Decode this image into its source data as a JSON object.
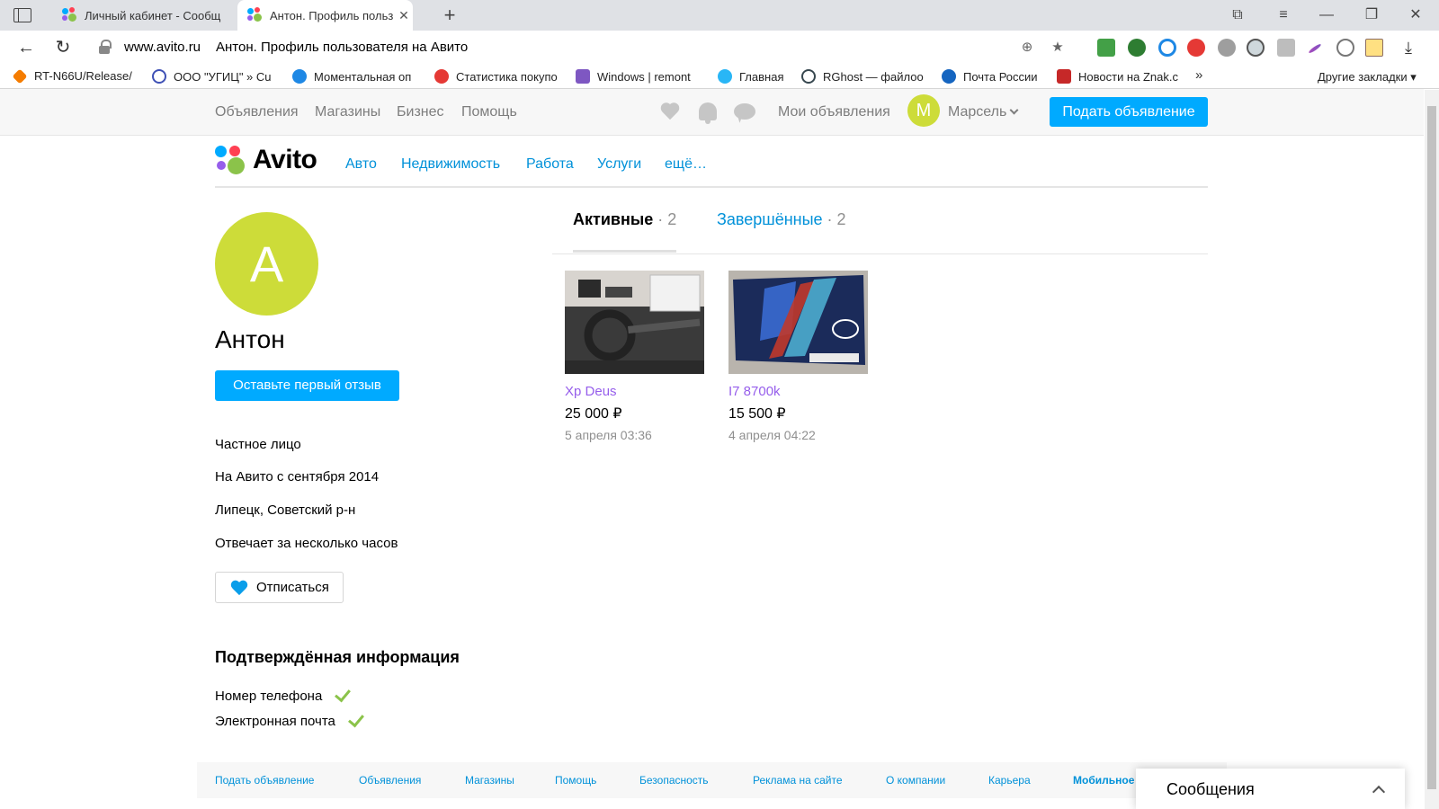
{
  "browser": {
    "tabs": [
      {
        "title": "Личный кабинет - Сообщ",
        "active": false
      },
      {
        "title": "Антон. Профиль польз",
        "active": true
      }
    ],
    "new_tab": "+",
    "close_glyph": "✕",
    "address": {
      "host": "www.avito.ru",
      "title": "Антон. Профиль пользователя на Авито"
    },
    "bookmarks": [
      {
        "label": "RT-N66U/Release/",
        "color": "#f57c00"
      },
      {
        "label": "ООО \"УГИЦ\" » Cu",
        "color": "#3f51b5"
      },
      {
        "label": "Моментальная оп",
        "color": "#1e88e5"
      },
      {
        "label": "Статистика покупо",
        "color": "#e53935"
      },
      {
        "label": "Windows | remont",
        "color": "#7e57c2"
      },
      {
        "label": "Главная",
        "color": "#29b6f6"
      },
      {
        "label": "RGhost — файлоо",
        "color": "#37474f"
      },
      {
        "label": "Почта России",
        "color": "#1565c0"
      },
      {
        "label": "Новости на Znak.c",
        "color": "#c62828"
      }
    ],
    "bookmarks_more": "»",
    "other_bookmarks": "Другие закладки ▾"
  },
  "avito": {
    "top_nav": [
      "Объявления",
      "Магазины",
      "Бизнес",
      "Помощь"
    ],
    "my_ads": "Мои объявления",
    "user": {
      "initial": "М",
      "name": "Марсель"
    },
    "post_button": "Подать объявление",
    "logo": "Avito",
    "categories": [
      "Авто",
      "Недвижимость",
      "Работа",
      "Услуги",
      "ещё…"
    ]
  },
  "profile": {
    "initial": "А",
    "name": "Антон",
    "review_button": "Оставьте первый отзыв",
    "info": [
      "Частное лицо",
      "На Авито с сентября 2014",
      "Липецк, Советский р-н",
      "Отвечает за несколько часов"
    ],
    "unsubscribe_button": "Отписаться",
    "verified_title": "Подтверждённая информация",
    "verified": [
      "Номер телефона",
      "Электронная почта"
    ]
  },
  "listings": {
    "tab_active": {
      "label": "Активные",
      "count": " · 2"
    },
    "tab_ended": {
      "label": "Завершённые",
      "count": " · 2"
    },
    "items": [
      {
        "title": "Xp Deus",
        "price": "25 000 ₽",
        "date": "5 апреля 03:36"
      },
      {
        "title": "I7 8700k",
        "price": "15 500 ₽",
        "date": "4 апреля 04:22"
      }
    ]
  },
  "footer": {
    "links": [
      "Подать объявление",
      "Объявления",
      "Магазины",
      "Помощь",
      "Безопасность",
      "Реклама на сайте",
      "О компании",
      "Карьера",
      "Мобильное п"
    ]
  },
  "messages": {
    "title": "Сообщения"
  },
  "colors": {
    "accent": "#00aaff",
    "link": "#0091d9",
    "visited": "#965eeb",
    "avatar": "#cddc39",
    "check": "#8bc34a"
  }
}
